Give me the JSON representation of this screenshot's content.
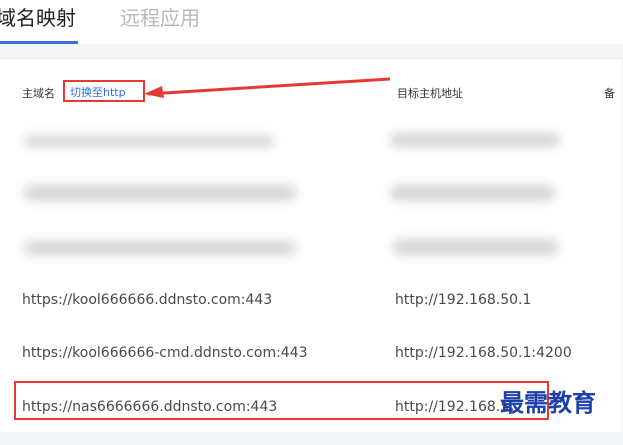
{
  "tabs": [
    {
      "label": "域名映射",
      "active": true
    },
    {
      "label": "远程应用",
      "active": false
    }
  ],
  "table": {
    "headers": {
      "domain": "主域名",
      "switch_link": "切换至http",
      "target": "目标主机地址",
      "note": "备"
    },
    "rows": [
      {
        "domain": "https://kool666666.ddnsto.com:443",
        "target": "http://192.168.50.1"
      },
      {
        "domain": "https://kool666666-cmd.ddnsto.com:443",
        "target": "http://192.168.50.1:4200"
      },
      {
        "domain": "https://nas6666666.ddnsto.com:443",
        "target": "http://192.168.5"
      }
    ]
  },
  "watermark": "最需教育",
  "colors": {
    "highlight": "#e53935",
    "link": "#2d6fe0",
    "tab_active_underline": "#3a72d8"
  }
}
